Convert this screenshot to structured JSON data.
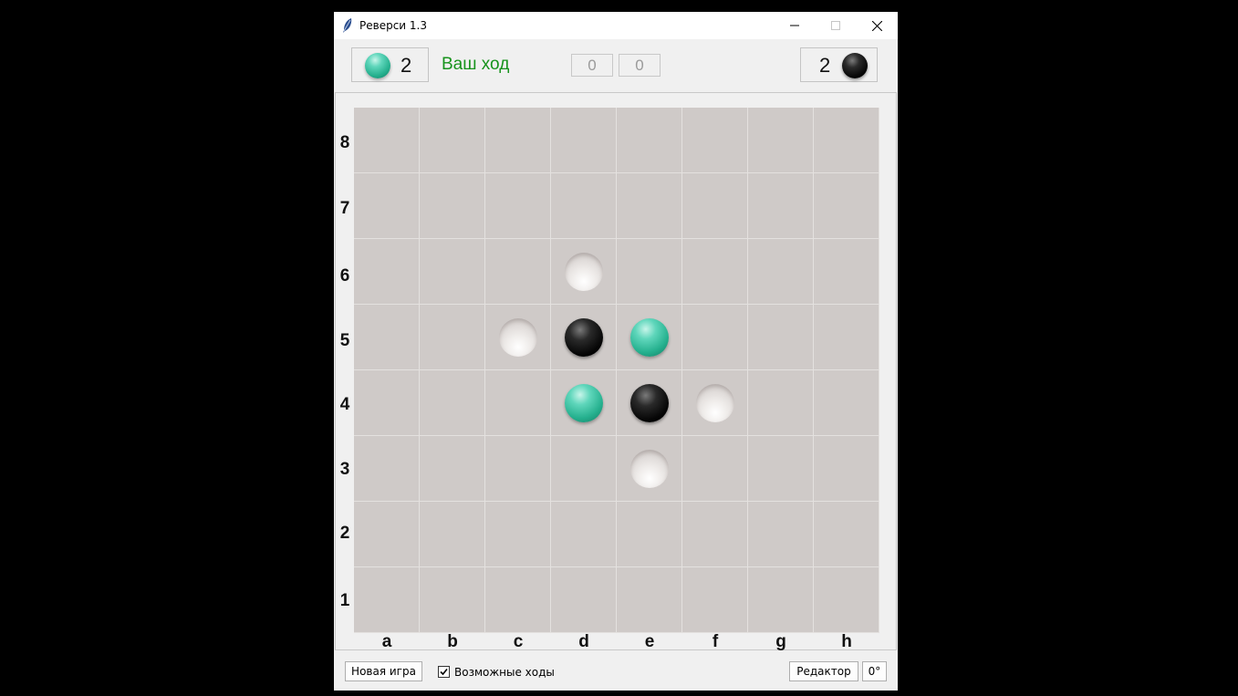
{
  "window": {
    "title": "Реверси 1.3"
  },
  "header": {
    "player_score": "2",
    "status": "Ваш ход",
    "counter_left": "0",
    "counter_right": "0",
    "opponent_score": "2"
  },
  "board": {
    "files": [
      "a",
      "b",
      "c",
      "d",
      "e",
      "f",
      "g",
      "h"
    ],
    "ranks": [
      "8",
      "7",
      "6",
      "5",
      "4",
      "3",
      "2",
      "1"
    ],
    "pieces": {
      "d5": "black",
      "e5": "teal",
      "d4": "teal",
      "e4": "black"
    },
    "hints": [
      "d6",
      "c5",
      "f4",
      "e3"
    ]
  },
  "footer": {
    "new_game": "Новая игра",
    "possible_moves_label": "Возможные ходы",
    "possible_moves_checked": true,
    "editor": "Редактор",
    "rotation": "0°"
  },
  "colors": {
    "status": "#17931c",
    "board_cell": "#cfcac8",
    "teal_stone": "#25b08e",
    "black_stone": "#050505"
  }
}
